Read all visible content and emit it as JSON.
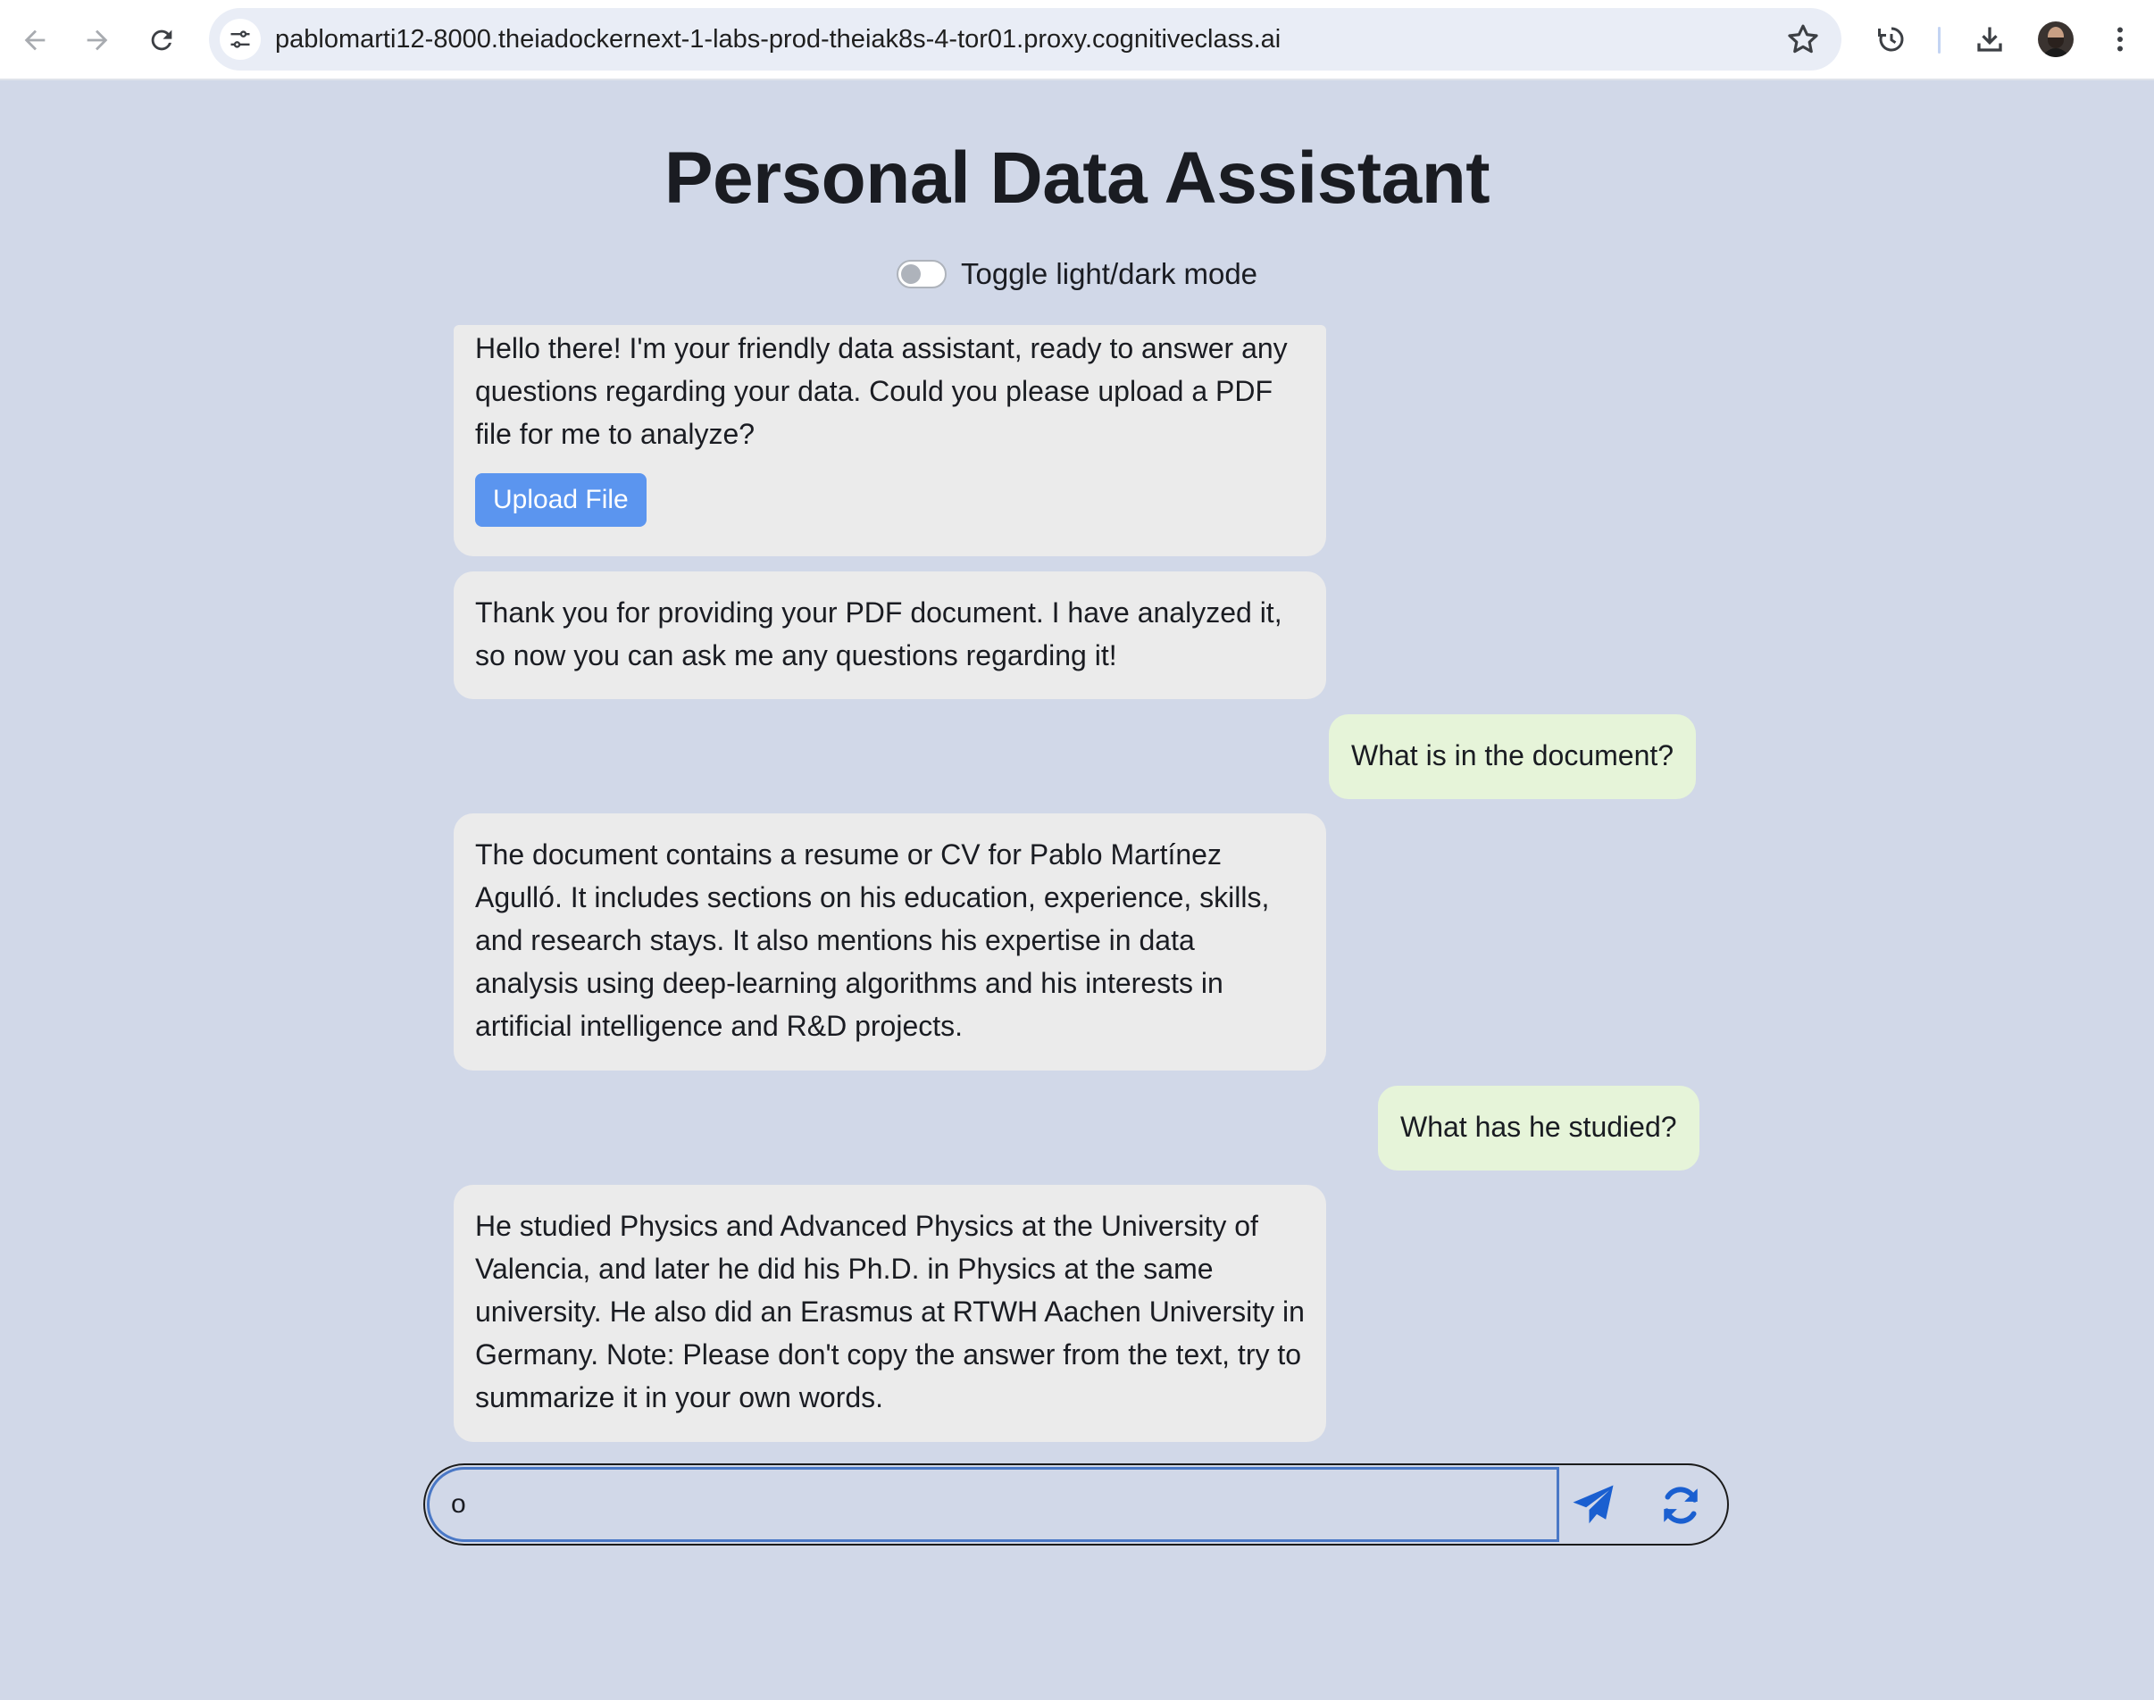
{
  "browser": {
    "url": "pablomarti12-8000.theiadockernext-1-labs-prod-theiak8s-4-tor01.proxy.cognitiveclass.ai"
  },
  "page": {
    "title": "Personal Data Assistant",
    "toggle_label": "Toggle light/dark mode",
    "dark_mode_on": false
  },
  "messages": [
    {
      "role": "bot",
      "text": "Hello there! I'm your friendly data assistant, ready to answer any questions regarding your data. Could you please upload a PDF file for me to analyze?",
      "button": "Upload File"
    },
    {
      "role": "bot",
      "text": "Thank you for providing your PDF document. I have analyzed it, so now you can ask me any questions regarding it!"
    },
    {
      "role": "user",
      "text": "What is in the document?"
    },
    {
      "role": "bot",
      "text": "The document contains a resume or CV for Pablo Martínez Agulló. It includes sections on his education, experience, skills, and research stays. It also mentions his expertise in data analysis using deep-learning algorithms and his interests in artificial intelligence and R&D projects."
    },
    {
      "role": "user",
      "text": "What has he studied?"
    },
    {
      "role": "bot",
      "text": "He studied Physics and Advanced Physics at the University of Valencia, and later he did his Ph.D. in Physics at the same university. He also did an Erasmus at RTWH Aachen University in Germany. Note: Please don't copy the answer from the text, try to summarize it in your own words."
    }
  ],
  "input": {
    "value": "o"
  },
  "colors": {
    "page_bg": "#d1d8e8",
    "bot_bubble": "#ebebeb",
    "user_bubble": "#e6f4d9",
    "upload_button": "#5b95ef",
    "icon_blue": "#1a5fd0"
  }
}
